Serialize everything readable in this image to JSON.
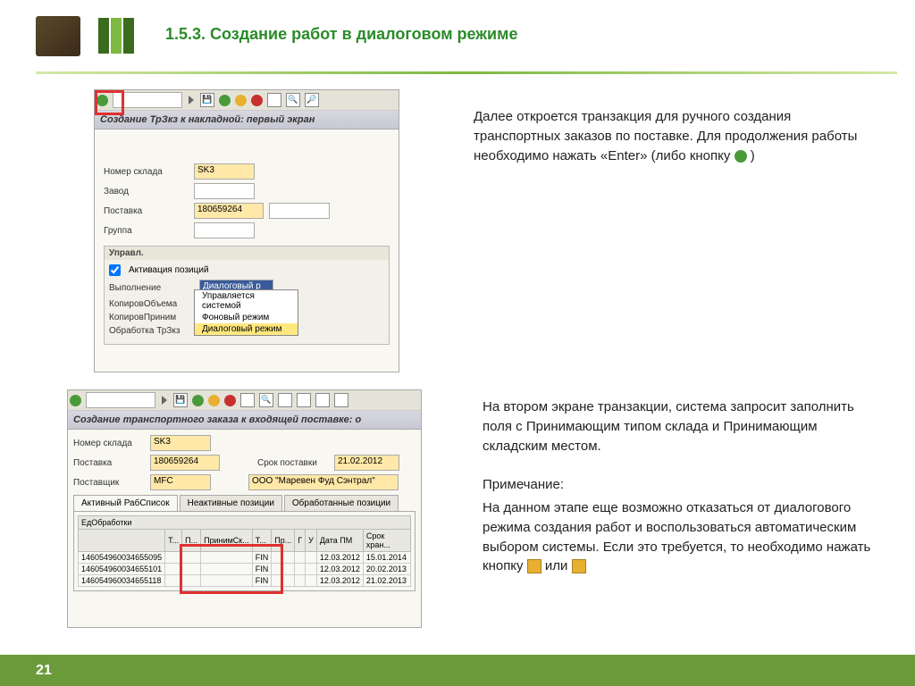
{
  "title": "1.5.3. Создание работ в диалоговом режиме",
  "page_num": "21",
  "txt1_p1": "Далее откроется транзакция для ручного создания транспортных заказов по поставке. Для продолжения работы необходимо нажать «Enter» (либо кнопку",
  "txt1_close": ")",
  "txt2_p1": "На втором экране транзакции, система запросит заполнить поля с Принимающим типом склада и Принимающим складским местом.",
  "txt2_p2_lbl": "Примечание:",
  "txt2_p2": "На данном этапе еще возможно отказаться от диалогового режима создания работ и воспользоваться автоматическим выбором системы. Если это требуется, то необходимо нажать кнопку",
  "txt2_or": "или",
  "sap1": {
    "title": "Создание ТрЗкз к накладной: первый экран",
    "fields": {
      "f1_lbl": "Номер склада",
      "f1_val": "SK3",
      "f2_lbl": "Завод",
      "f2_val": "",
      "f3_lbl": "Поставка",
      "f3_val": "180659264",
      "f4_lbl": "Группа",
      "f4_val": ""
    },
    "box_title": "Управл.",
    "chk_lbl": "Активация позиций",
    "exec_lbl": "Выполнение",
    "exec_val": "Диалоговый р",
    "row3_lbl": "КопировОбъема",
    "row4_lbl": "КопировПриним",
    "row5_lbl": "Обработка ТрЗкз",
    "drop_opt1": "Управляется системой",
    "drop_opt2": "Фоновый режим",
    "drop_opt3": "Диалоговый режим"
  },
  "sap2": {
    "title": "Создание транспортного заказа к входящей поставке: о",
    "f1_lbl": "Номер склада",
    "f1_val": "SK3",
    "f2_lbl": "Поставка",
    "f2_val": "180659264",
    "f2b_lbl": "Срок поставки",
    "f2b_val": "21.02.2012",
    "f3_lbl": "Поставщик",
    "f3_val": "MFC",
    "f3b_val": "ООО \"Маревен Фуд Сэнтрал\"",
    "tab1": "Активный РабСписок",
    "tab2": "Неактивные позиции",
    "tab3": "Обработанные позиции",
    "th_unit": "ЕдОбработки",
    "cols": [
      "",
      "Т...",
      "П...",
      "ПринимСк...",
      "Т...",
      "Пр...",
      "Г",
      "У",
      "Дата ПМ",
      "Срок хран..."
    ],
    "rows": [
      [
        "146054960034655095",
        "",
        "",
        "",
        "FIN",
        "",
        "",
        "",
        "12.03.2012",
        "15.01.2014"
      ],
      [
        "146054960034655101",
        "",
        "",
        "",
        "FIN",
        "",
        "",
        "",
        "12.03.2012",
        "20.02.2013"
      ],
      [
        "146054960034655118",
        "",
        "",
        "",
        "FIN",
        "",
        "",
        "",
        "12.03.2012",
        "21.02.2013"
      ]
    ]
  }
}
